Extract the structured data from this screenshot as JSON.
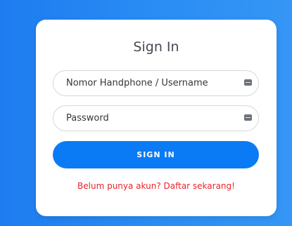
{
  "signin": {
    "title": "Sign In",
    "username_placeholder": "Nomor Handphone / Username",
    "password_placeholder": "Password",
    "button_label": "SIGN IN",
    "register_link": "Belum punya akun? Daftar sekarang!"
  },
  "icons": {
    "field_icon": "password-manager-key-icon"
  },
  "colors": {
    "background": "#2a8df4",
    "button": "#0a7bf5",
    "link": "#e8232c"
  }
}
